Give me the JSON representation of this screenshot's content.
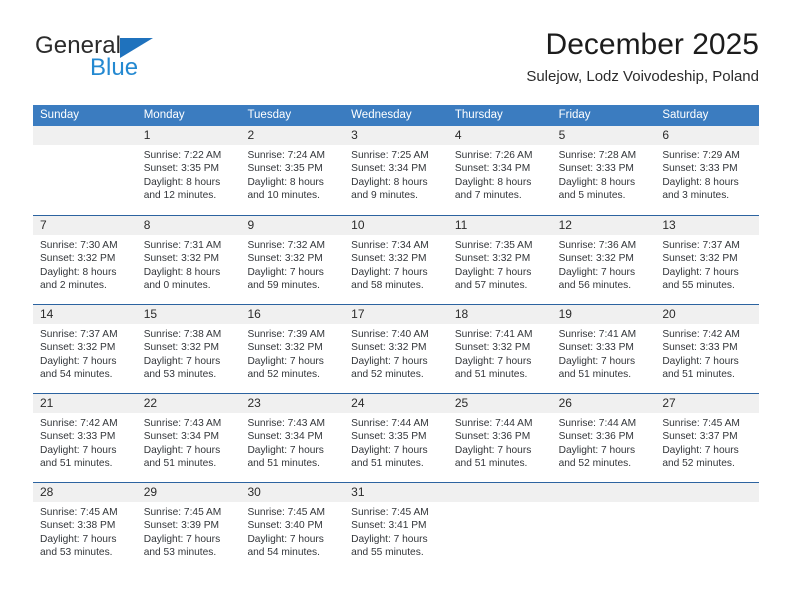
{
  "brand": {
    "name_top": "General",
    "name_bottom": "Blue",
    "triangle_color": "#1f72bd",
    "blue_color": "#2489d1"
  },
  "header": {
    "month_title": "December 2025",
    "location": "Sulejow, Lodz Voivodeship, Poland"
  },
  "theme": {
    "header_blue": "#3b7cc0",
    "row_border_blue": "#2c63a0",
    "day_band_gray": "#f0f0f0"
  },
  "weekdays": [
    "Sunday",
    "Monday",
    "Tuesday",
    "Wednesday",
    "Thursday",
    "Friday",
    "Saturday"
  ],
  "weeks": [
    {
      "days": [
        {
          "date": "",
          "lines": [
            "",
            "",
            "",
            ""
          ]
        },
        {
          "date": "1",
          "lines": [
            "Sunrise: 7:22 AM",
            "Sunset: 3:35 PM",
            "Daylight: 8 hours",
            "and 12 minutes."
          ]
        },
        {
          "date": "2",
          "lines": [
            "Sunrise: 7:24 AM",
            "Sunset: 3:35 PM",
            "Daylight: 8 hours",
            "and 10 minutes."
          ]
        },
        {
          "date": "3",
          "lines": [
            "Sunrise: 7:25 AM",
            "Sunset: 3:34 PM",
            "Daylight: 8 hours",
            "and 9 minutes."
          ]
        },
        {
          "date": "4",
          "lines": [
            "Sunrise: 7:26 AM",
            "Sunset: 3:34 PM",
            "Daylight: 8 hours",
            "and 7 minutes."
          ]
        },
        {
          "date": "5",
          "lines": [
            "Sunrise: 7:28 AM",
            "Sunset: 3:33 PM",
            "Daylight: 8 hours",
            "and 5 minutes."
          ]
        },
        {
          "date": "6",
          "lines": [
            "Sunrise: 7:29 AM",
            "Sunset: 3:33 PM",
            "Daylight: 8 hours",
            "and 3 minutes."
          ]
        }
      ]
    },
    {
      "days": [
        {
          "date": "7",
          "lines": [
            "Sunrise: 7:30 AM",
            "Sunset: 3:32 PM",
            "Daylight: 8 hours",
            "and 2 minutes."
          ]
        },
        {
          "date": "8",
          "lines": [
            "Sunrise: 7:31 AM",
            "Sunset: 3:32 PM",
            "Daylight: 8 hours",
            "and 0 minutes."
          ]
        },
        {
          "date": "9",
          "lines": [
            "Sunrise: 7:32 AM",
            "Sunset: 3:32 PM",
            "Daylight: 7 hours",
            "and 59 minutes."
          ]
        },
        {
          "date": "10",
          "lines": [
            "Sunrise: 7:34 AM",
            "Sunset: 3:32 PM",
            "Daylight: 7 hours",
            "and 58 minutes."
          ]
        },
        {
          "date": "11",
          "lines": [
            "Sunrise: 7:35 AM",
            "Sunset: 3:32 PM",
            "Daylight: 7 hours",
            "and 57 minutes."
          ]
        },
        {
          "date": "12",
          "lines": [
            "Sunrise: 7:36 AM",
            "Sunset: 3:32 PM",
            "Daylight: 7 hours",
            "and 56 minutes."
          ]
        },
        {
          "date": "13",
          "lines": [
            "Sunrise: 7:37 AM",
            "Sunset: 3:32 PM",
            "Daylight: 7 hours",
            "and 55 minutes."
          ]
        }
      ]
    },
    {
      "days": [
        {
          "date": "14",
          "lines": [
            "Sunrise: 7:37 AM",
            "Sunset: 3:32 PM",
            "Daylight: 7 hours",
            "and 54 minutes."
          ]
        },
        {
          "date": "15",
          "lines": [
            "Sunrise: 7:38 AM",
            "Sunset: 3:32 PM",
            "Daylight: 7 hours",
            "and 53 minutes."
          ]
        },
        {
          "date": "16",
          "lines": [
            "Sunrise: 7:39 AM",
            "Sunset: 3:32 PM",
            "Daylight: 7 hours",
            "and 52 minutes."
          ]
        },
        {
          "date": "17",
          "lines": [
            "Sunrise: 7:40 AM",
            "Sunset: 3:32 PM",
            "Daylight: 7 hours",
            "and 52 minutes."
          ]
        },
        {
          "date": "18",
          "lines": [
            "Sunrise: 7:41 AM",
            "Sunset: 3:32 PM",
            "Daylight: 7 hours",
            "and 51 minutes."
          ]
        },
        {
          "date": "19",
          "lines": [
            "Sunrise: 7:41 AM",
            "Sunset: 3:33 PM",
            "Daylight: 7 hours",
            "and 51 minutes."
          ]
        },
        {
          "date": "20",
          "lines": [
            "Sunrise: 7:42 AM",
            "Sunset: 3:33 PM",
            "Daylight: 7 hours",
            "and 51 minutes."
          ]
        }
      ]
    },
    {
      "days": [
        {
          "date": "21",
          "lines": [
            "Sunrise: 7:42 AM",
            "Sunset: 3:33 PM",
            "Daylight: 7 hours",
            "and 51 minutes."
          ]
        },
        {
          "date": "22",
          "lines": [
            "Sunrise: 7:43 AM",
            "Sunset: 3:34 PM",
            "Daylight: 7 hours",
            "and 51 minutes."
          ]
        },
        {
          "date": "23",
          "lines": [
            "Sunrise: 7:43 AM",
            "Sunset: 3:34 PM",
            "Daylight: 7 hours",
            "and 51 minutes."
          ]
        },
        {
          "date": "24",
          "lines": [
            "Sunrise: 7:44 AM",
            "Sunset: 3:35 PM",
            "Daylight: 7 hours",
            "and 51 minutes."
          ]
        },
        {
          "date": "25",
          "lines": [
            "Sunrise: 7:44 AM",
            "Sunset: 3:36 PM",
            "Daylight: 7 hours",
            "and 51 minutes."
          ]
        },
        {
          "date": "26",
          "lines": [
            "Sunrise: 7:44 AM",
            "Sunset: 3:36 PM",
            "Daylight: 7 hours",
            "and 52 minutes."
          ]
        },
        {
          "date": "27",
          "lines": [
            "Sunrise: 7:45 AM",
            "Sunset: 3:37 PM",
            "Daylight: 7 hours",
            "and 52 minutes."
          ]
        }
      ]
    },
    {
      "days": [
        {
          "date": "28",
          "lines": [
            "Sunrise: 7:45 AM",
            "Sunset: 3:38 PM",
            "Daylight: 7 hours",
            "and 53 minutes."
          ]
        },
        {
          "date": "29",
          "lines": [
            "Sunrise: 7:45 AM",
            "Sunset: 3:39 PM",
            "Daylight: 7 hours",
            "and 53 minutes."
          ]
        },
        {
          "date": "30",
          "lines": [
            "Sunrise: 7:45 AM",
            "Sunset: 3:40 PM",
            "Daylight: 7 hours",
            "and 54 minutes."
          ]
        },
        {
          "date": "31",
          "lines": [
            "Sunrise: 7:45 AM",
            "Sunset: 3:41 PM",
            "Daylight: 7 hours",
            "and 55 minutes."
          ]
        },
        {
          "date": "",
          "lines": [
            "",
            "",
            "",
            ""
          ]
        },
        {
          "date": "",
          "lines": [
            "",
            "",
            "",
            ""
          ]
        },
        {
          "date": "",
          "lines": [
            "",
            "",
            "",
            ""
          ]
        }
      ]
    }
  ]
}
